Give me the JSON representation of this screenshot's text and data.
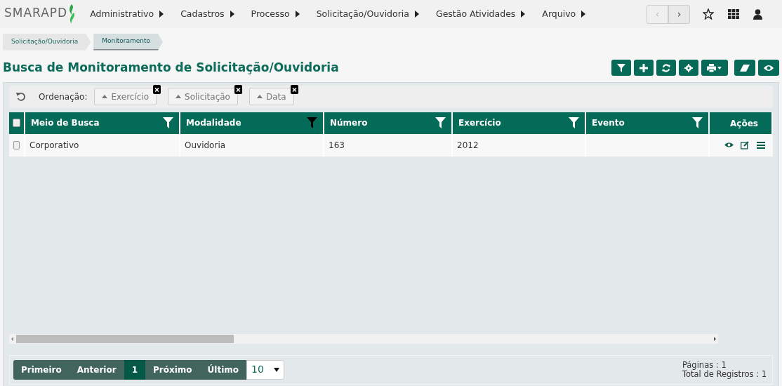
{
  "logo": {
    "text": "SMARAPD"
  },
  "menu": [
    {
      "label": "Administrativo"
    },
    {
      "label": "Cadastros"
    },
    {
      "label": "Processo"
    },
    {
      "label": "Solicitação/Ouvidoria"
    },
    {
      "label": "Gestão Atividades"
    },
    {
      "label": "Arquivo"
    }
  ],
  "nav_arrows": [
    {
      "label": "‹",
      "disabled": true
    },
    {
      "label": "›",
      "disabled": false
    }
  ],
  "breadcrumb": [
    {
      "label": "Solicitação/Ouvidoria",
      "selected": false
    },
    {
      "label": "Monitoramento",
      "selected": true
    }
  ],
  "page_title": "Busca de Monitoramento de Solicitação/Ouvidoria",
  "toolbar": [
    {
      "kind": "filter"
    },
    {
      "kind": "add"
    },
    {
      "kind": "refresh"
    },
    {
      "kind": "settings"
    },
    {
      "kind": "print"
    },
    {
      "kind": "eraser"
    },
    {
      "kind": "view"
    }
  ],
  "sort_bar": {
    "label": "Ordenação:",
    "chips": [
      {
        "label": "Exercício"
      },
      {
        "label": "Solicitação"
      },
      {
        "label": "Data"
      }
    ]
  },
  "table": {
    "all_checked": false,
    "columns": [
      {
        "label": "Meio de Busca",
        "filter_active": false
      },
      {
        "label": "Modalidade",
        "filter_active": true
      },
      {
        "label": "Número",
        "filter_active": false
      },
      {
        "label": "Exercício",
        "filter_active": false
      },
      {
        "label": "Evento",
        "filter_active": false
      }
    ],
    "actions_label": "Ações",
    "rows": [
      {
        "checked": false,
        "cells": [
          "Corporativo",
          "Ouvidoria",
          "163",
          "2012",
          ""
        ]
      }
    ]
  },
  "pagination": {
    "buttons": [
      {
        "label": "Primeiro",
        "selected": false
      },
      {
        "label": "Anterior",
        "selected": false
      },
      {
        "label": "1",
        "selected": true
      },
      {
        "label": "Próximo",
        "selected": false
      },
      {
        "label": "Último",
        "selected": false
      }
    ],
    "page_size": "10"
  },
  "summary": [
    "Páginas : 1",
    "Total de Registros : 1"
  ]
}
